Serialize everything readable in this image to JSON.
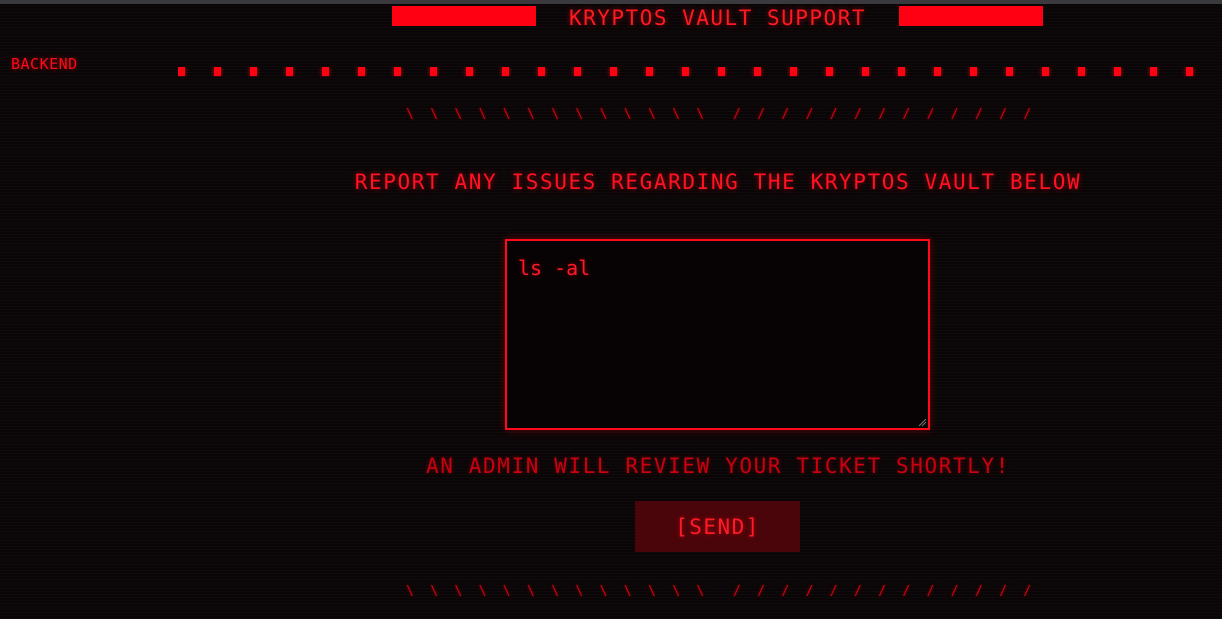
{
  "header": {
    "title": "KRYPTOS VAULT SUPPORT"
  },
  "sidebar": {
    "label": "BACKEND"
  },
  "form": {
    "heading": "REPORT ANY ISSUES REGARDING THE KRYPTOS VAULT BELOW",
    "ticket_value": "ls -al",
    "notice": "AN ADMIN WILL REVIEW YOUR TICKET SHORTLY!",
    "send_label": "[SEND]"
  },
  "theme": {
    "accent": "#ff0012",
    "background": "#0a0506",
    "button_bg": "#4a050a"
  }
}
